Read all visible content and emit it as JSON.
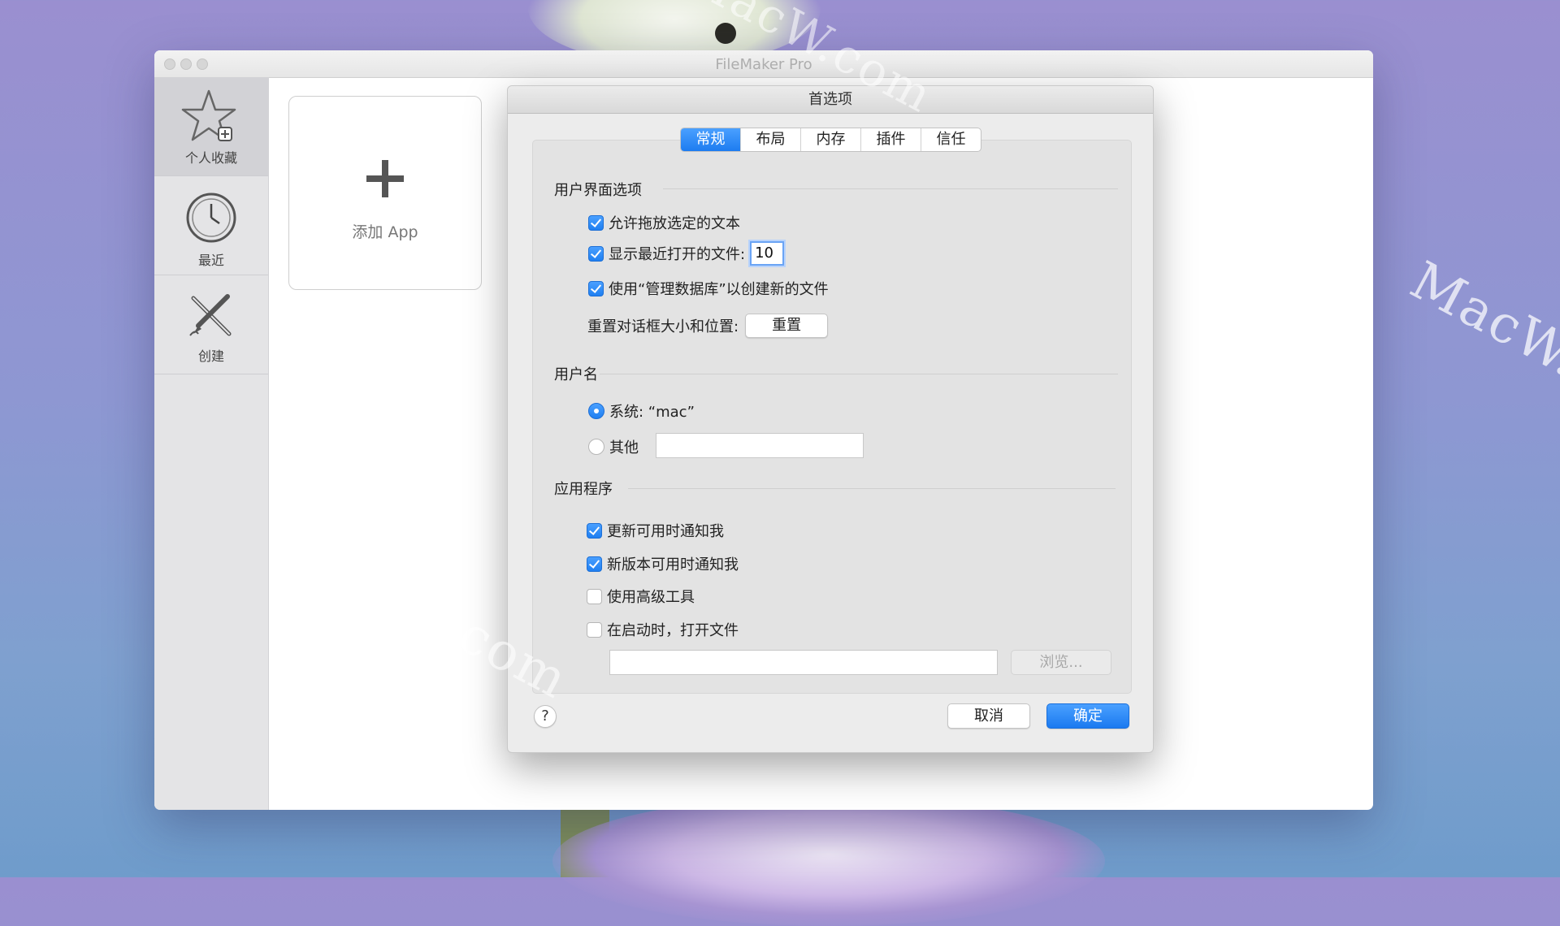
{
  "app": {
    "title": "FileMaker Pro"
  },
  "watermark": {
    "text": "MacW.com"
  },
  "sidebar": {
    "items": [
      {
        "label": "个人收藏",
        "icon": "star-add-icon",
        "active": true
      },
      {
        "label": "最近",
        "icon": "clock-icon",
        "active": false
      },
      {
        "label": "创建",
        "icon": "pencil-ruler-icon",
        "active": false
      }
    ]
  },
  "add_app": {
    "label": "添加 App",
    "icon": "plus-icon"
  },
  "dialog": {
    "title": "首选项",
    "tabs": [
      "常规",
      "布局",
      "内存",
      "插件",
      "信任"
    ],
    "active_tab": "常规",
    "ui_options": {
      "title": "用户界面选项",
      "allow_drag_drop": {
        "label": "允许拖放选定的文本",
        "checked": true
      },
      "show_recent": {
        "label": "显示最近打开的文件:",
        "checked": true,
        "value": "10"
      },
      "use_manage_db": {
        "label": "使用“管理数据库”以创建新的文件",
        "checked": true
      },
      "reset_dialog": {
        "label": "重置对话框大小和位置:",
        "button": "重置"
      }
    },
    "username": {
      "title": "用户名",
      "system": {
        "label": "系统: “mac”",
        "selected": true
      },
      "other": {
        "label": "其他",
        "selected": false,
        "value": ""
      }
    },
    "application": {
      "title": "应用程序",
      "notify_updates": {
        "label": "更新可用时通知我",
        "checked": true
      },
      "notify_new_version": {
        "label": "新版本可用时通知我",
        "checked": true
      },
      "advanced_tools": {
        "label": "使用高级工具",
        "checked": false
      },
      "open_on_launch": {
        "label": "在启动时，打开文件",
        "checked": false
      },
      "file_path": "",
      "browse_button": "浏览..."
    },
    "help_button": "?",
    "cancel_button": "取消",
    "ok_button": "确定"
  },
  "colors": {
    "accent": "#1d7cf0",
    "background_top": "#9a8fd0",
    "background_bottom": "#6f9ccb"
  }
}
